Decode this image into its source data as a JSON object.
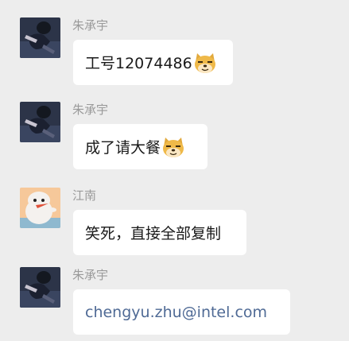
{
  "messages": [
    {
      "sender": "朱承宇",
      "text": "工号12074486",
      "emoji": "doge-emoji",
      "avatar": "dark-figure-avatar"
    },
    {
      "sender": "朱承宇",
      "text": "成了请大餐",
      "emoji": "doge-emoji",
      "avatar": "dark-figure-avatar"
    },
    {
      "sender": "江南",
      "text": "笑死，直接全部复制",
      "avatar": "cartoon-penguin-avatar"
    },
    {
      "sender": "朱承宇",
      "text": "chengyu.zhu@intel.com",
      "is_link": true,
      "avatar": "dark-figure-avatar"
    }
  ],
  "colors": {
    "background": "#ededed",
    "bubble": "#ffffff",
    "sender_name": "#9a9a9a",
    "link": "#4f6a95"
  }
}
